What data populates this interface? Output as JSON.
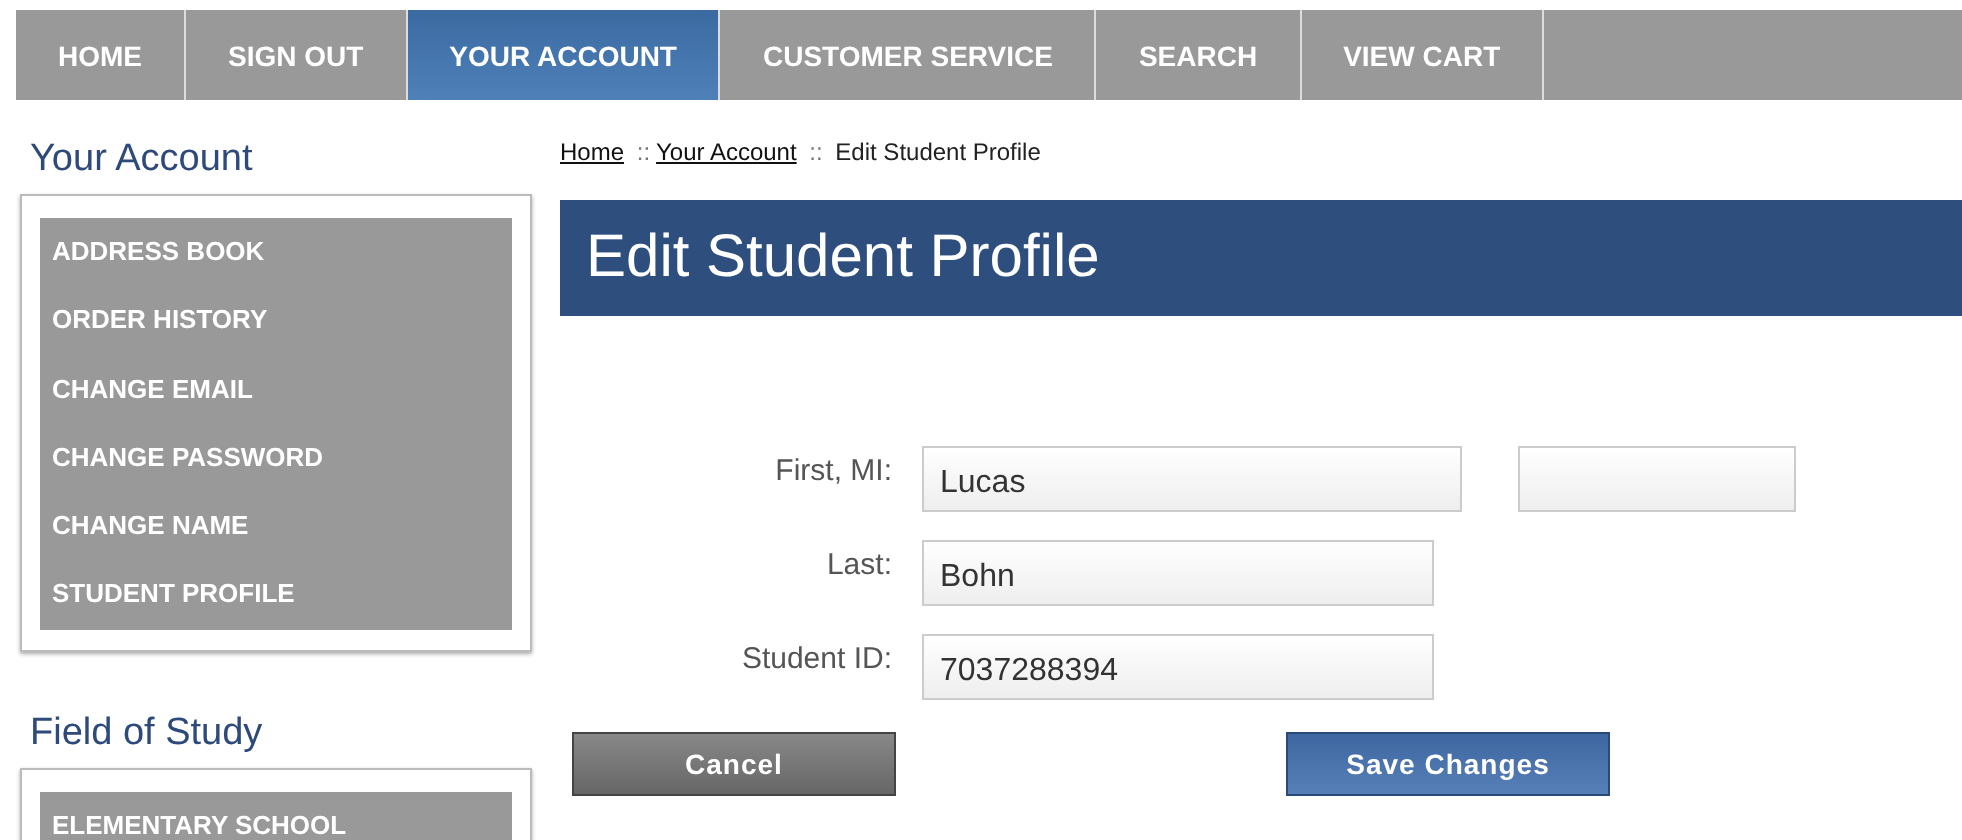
{
  "nav": [
    {
      "label": "HOME",
      "selected": false
    },
    {
      "label": "SIGN OUT",
      "selected": false
    },
    {
      "label": "YOUR ACCOUNT",
      "selected": true
    },
    {
      "label": "CUSTOMER SERVICE",
      "selected": false
    },
    {
      "label": "SEARCH",
      "selected": false
    },
    {
      "label": "VIEW CART",
      "selected": false
    }
  ],
  "sidebar": [
    {
      "title": "Your Account",
      "items": [
        "ADDRESS BOOK",
        "ORDER HISTORY",
        "CHANGE EMAIL",
        "CHANGE PASSWORD",
        "CHANGE NAME",
        "STUDENT PROFILE"
      ]
    },
    {
      "title": "Field of Study",
      "items": [
        "ELEMENTARY SCHOOL"
      ]
    }
  ],
  "breadcrumb": {
    "links": [
      "Home",
      "Your Account"
    ],
    "separator": "::",
    "current": "Edit Student Profile"
  },
  "page_title": "Edit Student Profile",
  "form": [
    {
      "label": "First, MI:",
      "value": "Lucas",
      "extra_field": true
    },
    {
      "label": "Last:",
      "value": "Bohn",
      "extra_field": false
    },
    {
      "label": "Student ID:",
      "value": "7037288394",
      "extra_field": false
    }
  ],
  "buttons": {
    "cancel": "Cancel",
    "save": "Save Changes"
  }
}
